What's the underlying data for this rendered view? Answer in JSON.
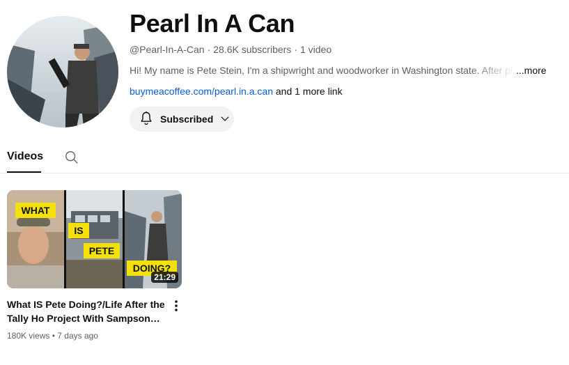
{
  "channel": {
    "title": "Pearl In A Can",
    "handle": "@Pearl-In-A-Can",
    "subscribers": "28.6K subscribers",
    "video_count": "1 video",
    "separator": "·",
    "description": "Hi! My name is Pete Stein, I'm a shipwright and woodworker in Washington state. After pl",
    "more_label": "...more",
    "link_text": "buymeacoffee.com/pearl.in.a.can",
    "more_links": "and 1 more link",
    "subscribe_label": "Subscribed"
  },
  "icons": {
    "bell": "bell-icon",
    "chevron": "chevron-down-icon",
    "search": "search-icon",
    "kebab": "more-vert-icon"
  },
  "tabs": [
    {
      "label": "Videos",
      "active": true
    }
  ],
  "videos": [
    {
      "title": "What IS Pete Doing?/Life After the Tally Ho Project With Sampson Bo…",
      "duration": "21:29",
      "views": "180K views",
      "age": "7 days ago",
      "thumbnail_text": [
        "WHAT",
        "IS",
        "PETE",
        "DOING?"
      ]
    }
  ],
  "colors": {
    "link": "#065fd4",
    "subscribe_bg": "#f2f2f2",
    "thumb_yellow": "#f5e10a"
  }
}
